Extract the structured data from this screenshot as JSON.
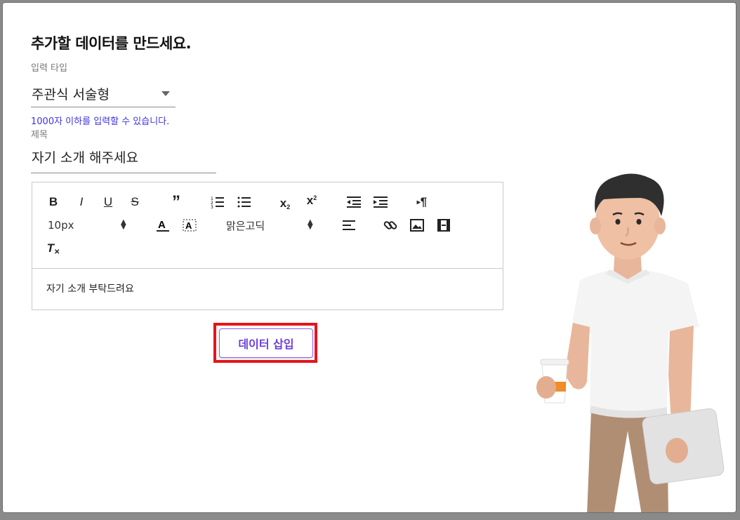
{
  "dialog": {
    "title": "추가할 데이터를 만드세요.",
    "input_type": {
      "label": "입력 타입",
      "value": "주관식 서술형",
      "helper": "1000자 이하를 입력할 수 있습니다."
    },
    "title_field": {
      "label": "제목",
      "value": "자기 소개 해주세요"
    },
    "editor": {
      "font_size": "10px",
      "font_family": "맑은고딕",
      "content": "자기 소개 부탁드려요",
      "toolbar_icons": [
        "bold-icon",
        "italic-icon",
        "underline-icon",
        "strikethrough-icon",
        "blockquote-icon",
        "ordered-list-icon",
        "bullet-list-icon",
        "subscript-icon",
        "superscript-icon",
        "outdent-icon",
        "indent-icon",
        "text-direction-icon",
        "font-color-icon",
        "background-color-icon",
        "align-icon",
        "link-icon",
        "image-icon",
        "video-icon",
        "clear-format-icon"
      ]
    },
    "insert_button": "데이터 삽입"
  },
  "colors": {
    "helper_text": "#3d33e0",
    "button_text": "#6d3fd9",
    "highlight": "#e5141b"
  }
}
